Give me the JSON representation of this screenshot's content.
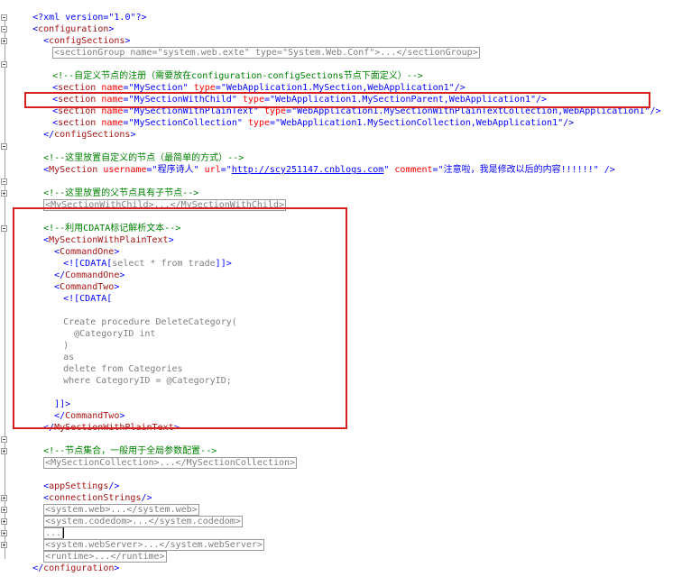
{
  "lines": {
    "l1": {
      "decl_open": "<?xml version=",
      "decl_val": "\"1.0\"",
      "decl_close": "?>"
    },
    "l2": {
      "text": "configuration"
    },
    "l3": {
      "text": "configSections"
    },
    "l4": {
      "text": "<sectionGroup name=\"system.web.exte\" type=\"System.Web.Conf\">...</sectionGroup>"
    },
    "l5": {
      "text": "<!--自定义节点的注册（需要放在configuration-configSections节点下面定义）-->"
    },
    "l6": {
      "tag": "section",
      "a1": "name",
      "v1": "\"MySection\"",
      "a2": "type",
      "v2": "\"WebApplication1.MySection,WebApplication1\""
    },
    "l7": {
      "tag": "section",
      "a1": "name",
      "v1": "\"MySectionWithChild\"",
      "a2": "type",
      "v2": "\"WebApplication1.MySectionParent,WebApplication1\""
    },
    "l8": {
      "tag": "section",
      "a1": "name",
      "v1": "\"MySectionWithPlainText\"",
      "a2": "type",
      "v2": "\"WebApplication1.MySectionWithPlainTextCollection,WebApplication1\""
    },
    "l9": {
      "tag": "section",
      "a1": "name",
      "v1": "\"MySectionCollection\"",
      "a2": "type",
      "v2": "\"WebApplication1.MySectionCollection,WebApplication1\""
    },
    "l10": {
      "text": "configSections"
    },
    "l11": {
      "text": "<!--这里放置自定义的节点（最简单的方式）-->"
    },
    "l12": {
      "tag": "MySection",
      "a1": "username",
      "v1": "\"程序诗人\"",
      "a2": "url",
      "v2q1": "\"",
      "v2link": "http://scy251147.cnblogs.com",
      "v2q2": "\"",
      "a3": "comment",
      "v3": "\"注意啦，我是修改以后的内容!!!!!!\""
    },
    "l13": {
      "text": "<!--这里放置的父节点具有子节点-->"
    },
    "l14": {
      "text": "<MySectionWithChild>...</MySectionWithChild>"
    },
    "l15": {
      "text": "<!--利用CDATA标记解析文本-->"
    },
    "l16": {
      "text": "MySectionWithPlainText"
    },
    "l17": {
      "text": "CommandOne"
    },
    "l18": {
      "open": "<![CDATA[",
      "body": "select * from trade",
      "close": "]]>"
    },
    "l19": {
      "text": "CommandOne"
    },
    "l20": {
      "text": "CommandTwo"
    },
    "l21": {
      "text": "<![CDATA["
    },
    "l22": {
      "text": ""
    },
    "l23": {
      "text": "Create procedure DeleteCategory("
    },
    "l24": {
      "text": "  @CategoryID int"
    },
    "l25": {
      "text": ")"
    },
    "l26": {
      "text": "as"
    },
    "l27": {
      "text": "delete from Categories"
    },
    "l28": {
      "text": "where CategoryID = @CategoryID;"
    },
    "l29": {
      "text": ""
    },
    "l30": {
      "text": "]]>"
    },
    "l31": {
      "text": "CommandTwo"
    },
    "l32": {
      "text": "MySectionWithPlainText"
    },
    "l33": {
      "text": "<!--节点集合，一般用于全局参数配置-->"
    },
    "l34": {
      "text": "<MySectionCollection>...</MySectionCollection>"
    },
    "l35": {
      "text": "appSettings"
    },
    "l36": {
      "text": "connectionStrings"
    },
    "l37": {
      "text": "<system.web>...</system.web>"
    },
    "l38": {
      "text": "<system.codedom>...</system.codedom>"
    },
    "l39": {
      "text": "..."
    },
    "l40": {
      "text": "<system.webServer>...</system.webServer>"
    },
    "l41": {
      "text": "<runtime>...</runtime>"
    },
    "l42": {
      "text": "configuration"
    }
  },
  "colors": {
    "tag_bracket": "#0000ff",
    "element_name": "#a31515",
    "attribute_name": "#ff0000",
    "attribute_value": "#0000ff",
    "comment": "#008000",
    "collapsed_text": "#808080",
    "highlight_box": "#d62020"
  }
}
